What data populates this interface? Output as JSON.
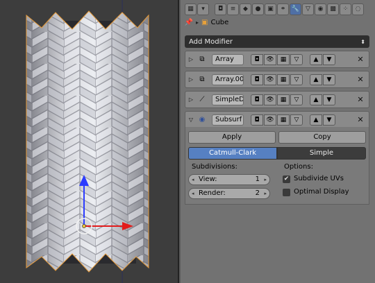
{
  "header": {
    "context_icons": [
      "render-icon",
      "render-layers-icon",
      "scene-icon",
      "world-icon",
      "object-icon",
      "constraints-icon",
      "modifiers-icon",
      "data-icon",
      "material-icon",
      "texture-icon",
      "particles-icon",
      "physics-icon"
    ],
    "active_context": "modifiers-icon",
    "breadcrumb": "Cube"
  },
  "add_modifier": {
    "label": "Add Modifier"
  },
  "modifiers": [
    {
      "name": "Array",
      "expanded": false,
      "icon": "array-modifier-icon"
    },
    {
      "name": "Array.00",
      "expanded": false,
      "icon": "array-modifier-icon"
    },
    {
      "name": "SimpleD",
      "expanded": false,
      "icon": "simple-deform-modifier-icon"
    },
    {
      "name": "Subsurf",
      "expanded": true,
      "icon": "subsurf-modifier-icon"
    }
  ],
  "subsurf": {
    "apply_label": "Apply",
    "copy_label": "Copy",
    "types": [
      "Catmull-Clark",
      "Simple"
    ],
    "active_type": "Catmull-Clark",
    "subdivisions_label": "Subdivisions:",
    "view_label": "View:",
    "view_value": "1",
    "render_label": "Render:",
    "render_value": "2",
    "options_label": "Options:",
    "subdivide_uvs_label": "Subdivide UVs",
    "subdivide_uvs_checked": true,
    "optimal_display_label": "Optimal Display",
    "optimal_display_checked": false
  },
  "colors": {
    "viewport_bg": "#3d3d3d",
    "active_blue": "#5680c2",
    "panel_bg": "#727272"
  }
}
